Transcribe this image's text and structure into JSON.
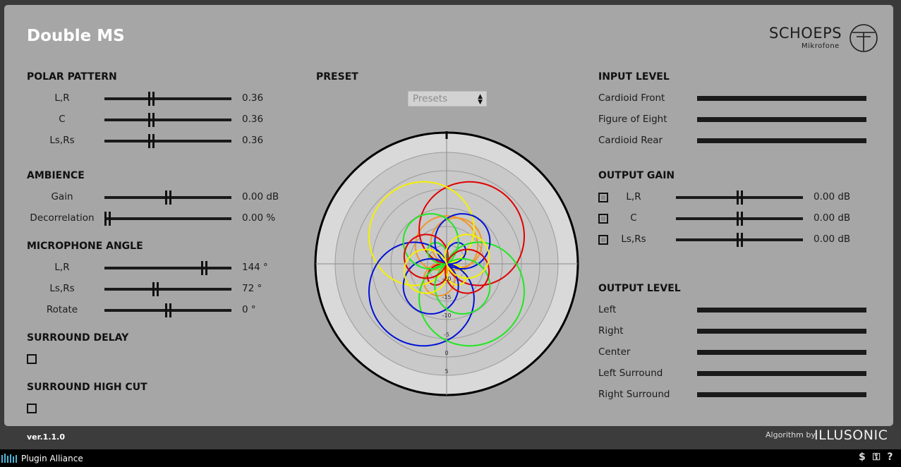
{
  "title": "Double MS",
  "brand": {
    "name": "SCHOEPS",
    "sub": "Mikrofone"
  },
  "polar_pattern": {
    "label": "POLAR PATTERN",
    "rows": [
      {
        "label": "L,R",
        "value": "0.36",
        "pos": 0.36
      },
      {
        "label": "C",
        "value": "0.36",
        "pos": 0.36
      },
      {
        "label": "Ls,Rs",
        "value": "0.36",
        "pos": 0.36
      }
    ]
  },
  "ambience": {
    "label": "AMBIENCE",
    "rows": [
      {
        "label": "Gain",
        "value": "0.00 dB",
        "pos": 0.5
      },
      {
        "label": "Decorrelation",
        "value": "0.00 %",
        "pos": 0.0
      }
    ]
  },
  "microphone_angle": {
    "label": "MICROPHONE ANGLE",
    "rows": [
      {
        "label": "L,R",
        "value": "144 °",
        "pos": 0.8
      },
      {
        "label": "Ls,Rs",
        "value": "72 °",
        "pos": 0.4
      },
      {
        "label": "Rotate",
        "value": "0 °",
        "pos": 0.5
      }
    ]
  },
  "surround_delay": {
    "label": "SURROUND DELAY",
    "checked": false
  },
  "surround_high_cut": {
    "label": "SURROUND HIGH CUT",
    "checked": false
  },
  "preset": {
    "label": "PRESET",
    "select_value": "Presets"
  },
  "polar_plot": {
    "ring_labels": [
      "-20",
      "-15",
      "-10",
      "-5",
      "0",
      "5"
    ]
  },
  "input_level": {
    "label": "INPUT LEVEL",
    "rows": [
      {
        "label": "Cardioid Front",
        "level": 1.0
      },
      {
        "label": "Figure of Eight",
        "level": 1.0
      },
      {
        "label": "Cardioid Rear",
        "level": 1.0
      }
    ]
  },
  "output_gain": {
    "label": "OUTPUT GAIN",
    "rows": [
      {
        "label": "L,R",
        "value": "0.00 dB",
        "pos": 0.5
      },
      {
        "label": "C",
        "value": "0.00 dB",
        "pos": 0.5
      },
      {
        "label": "Ls,Rs",
        "value": "0.00 dB",
        "pos": 0.5
      }
    ]
  },
  "output_level": {
    "label": "OUTPUT LEVEL",
    "rows": [
      {
        "label": "Left",
        "level": 1.0
      },
      {
        "label": "Right",
        "level": 1.0
      },
      {
        "label": "Center",
        "level": 1.0
      },
      {
        "label": "Left Surround",
        "level": 1.0
      },
      {
        "label": "Right Surround",
        "level": 1.0
      }
    ]
  },
  "footer": {
    "version": "ver.1.1.0",
    "algorithm_by": "Algorithm by",
    "algorithm_brand": "ILLUSONIC"
  },
  "plugin_alliance": {
    "label": "Plugin Alliance",
    "icons": [
      "dollar-icon",
      "key-icon",
      "help-icon"
    ]
  },
  "colors": {
    "panel": "#a6a6a6",
    "pattern_red": "#e00000",
    "pattern_blue": "#0012d6",
    "pattern_green": "#22e622",
    "pattern_yellow": "#f6f000",
    "pattern_orange": "#f0962a"
  }
}
